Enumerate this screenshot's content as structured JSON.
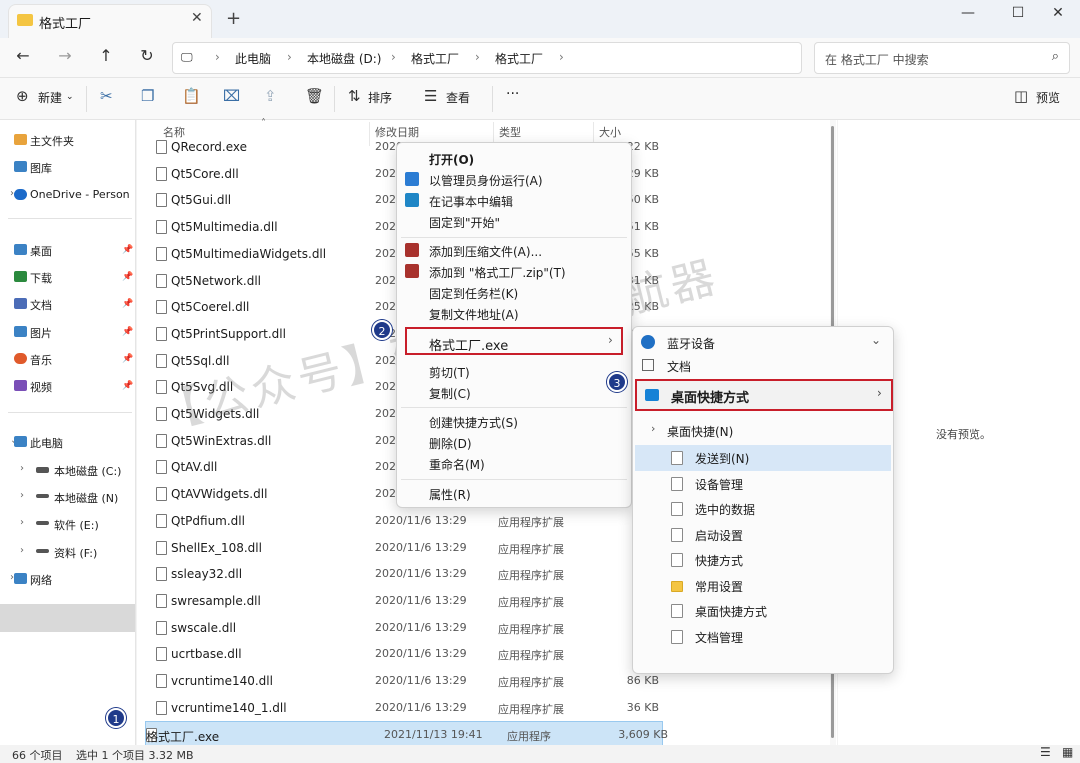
{
  "window": {
    "tab_title": "格式工厂",
    "tab_close": "✕",
    "new_tab": "+"
  },
  "nav_buttons": {
    "back": "←",
    "forward": "→",
    "up": "↑",
    "refresh": "↻"
  },
  "breadcrumb": {
    "pc": "此电脑",
    "drive": "本地磁盘 (D:)",
    "folder1": "格式工厂",
    "folder2": "格式工厂",
    "sep": "›"
  },
  "search": {
    "placeholder": "在 格式工厂 中搜索"
  },
  "toolbar": {
    "new": "新建",
    "sort": "排序",
    "view": "查看",
    "more": "···",
    "preview": "预览"
  },
  "nav_pane": {
    "quick": [
      {
        "label": "主文件夹",
        "color": "#e8a33c"
      },
      {
        "label": "图库",
        "color": "#3b82c4"
      },
      {
        "label": "OneDrive - Person",
        "color": "#1b6ac9"
      }
    ],
    "pinned": [
      {
        "label": "桌面",
        "color": "#3b82c4"
      },
      {
        "label": "下载",
        "color": "#2b8a3e"
      },
      {
        "label": "文档",
        "color": "#4b6cb7"
      },
      {
        "label": "图片",
        "color": "#3b82c4"
      },
      {
        "label": "音乐",
        "color": "#e05a2b"
      },
      {
        "label": "视频",
        "color": "#7a4fb7"
      }
    ],
    "tree": [
      {
        "label": "此电脑",
        "color": "#3b82c4"
      },
      {
        "label": "本地磁盘 (C:)",
        "color": "#555555"
      },
      {
        "label": "本地磁盘 (N)",
        "color": "#555555"
      },
      {
        "label": "软件 (E:)",
        "color": "#555555"
      },
      {
        "label": "资料 (F:)",
        "color": "#555555"
      },
      {
        "label": "网络",
        "color": "#3b82c4"
      }
    ]
  },
  "columns": {
    "name": "名称",
    "date": "修改日期",
    "type": "类型",
    "size": "大小"
  },
  "files": [
    {
      "name": "QRecord.exe",
      "date": "2020",
      "type": "",
      "size": "22 KB"
    },
    {
      "name": "Qt5Core.dll",
      "date": "2020",
      "type": "",
      "size": "29 KB"
    },
    {
      "name": "Qt5Gui.dll",
      "date": "2020",
      "type": "",
      "size": "50 KB"
    },
    {
      "name": "Qt5Multimedia.dll",
      "date": "2020",
      "type": "",
      "size": "51 KB"
    },
    {
      "name": "Qt5MultimediaWidgets.dll",
      "date": "2020",
      "type": "",
      "size": "55 KB"
    },
    {
      "name": "Qt5Network.dll",
      "date": "2020",
      "type": "",
      "size": "31 KB"
    },
    {
      "name": "Qt5Coerel.dll",
      "date": "2020",
      "type": "",
      "size": "25 KB"
    },
    {
      "name": "Qt5PrintSupport.dll",
      "date": "2020",
      "type": "",
      "size": "36 KB"
    },
    {
      "name": "Qt5Sql.dll",
      "date": "2020",
      "type": "",
      "size": "22 KB"
    },
    {
      "name": "Qt5Svg.dll",
      "date": "2020",
      "type": "",
      "size": "31 KB"
    },
    {
      "name": "Qt5Widgets.dll",
      "date": "2020",
      "type": "",
      "size": "44 KB"
    },
    {
      "name": "Qt5WinExtras.dll",
      "date": "2020",
      "type": "",
      "size": "38 KB"
    },
    {
      "name": "QtAV.dll",
      "date": "2020",
      "type": "",
      "size": "44 KB"
    },
    {
      "name": "QtAVWidgets.dll",
      "date": "2020",
      "type": "",
      "size": "83 KB"
    },
    {
      "name": "QtPdfium.dll",
      "date": "2020/11/6 13:29",
      "type": "应用程序扩展",
      "size": "4,1"
    },
    {
      "name": "ShellEx_108.dll",
      "date": "2020/11/6 13:29",
      "type": "应用程序扩展",
      "size": "3"
    },
    {
      "name": "ssleay32.dll",
      "date": "2020/11/6 13:29",
      "type": "应用程序扩展",
      "size": "30"
    },
    {
      "name": "swresample.dll",
      "date": "2020/11/6 13:29",
      "type": "应用程序扩展",
      "size": "1,0"
    },
    {
      "name": "swscale.dll",
      "date": "2020/11/6 13:29",
      "type": "应用程序扩展",
      "size": "3"
    },
    {
      "name": "ucrtbase.dll",
      "date": "2020/11/6 13:29",
      "type": "应用程序扩展",
      "size": "1,0"
    },
    {
      "name": "vcruntime140.dll",
      "date": "2020/11/6 13:29",
      "type": "应用程序扩展",
      "size": "86 KB"
    },
    {
      "name": "vcruntime140_1.dll",
      "date": "2020/11/6 13:29",
      "type": "应用程序扩展",
      "size": "36 KB"
    },
    {
      "name": "格式工厂.exe",
      "date": "2021/11/13 19:41",
      "type": "应用程序",
      "size": "3,609 KB"
    }
  ],
  "preview_text": "没有预览。",
  "status": {
    "count": "66 个项目",
    "selected": "选中 1 个项目  3.32 MB"
  },
  "context_menu": {
    "items": [
      {
        "label": "打开(O)",
        "icon": "none",
        "color": ""
      },
      {
        "label": "以管理员身份运行(A)",
        "icon": "shield-icon",
        "color": "#2b7cd3"
      },
      {
        "label": "在记事本中编辑",
        "icon": "notepad-icon",
        "color": "#1f86c6"
      },
      {
        "label": "固定到\"开始\"",
        "icon": "none",
        "color": ""
      },
      {
        "label": "添加到压缩文件(A)...",
        "icon": "winrar-icon",
        "color": "#a8322d"
      },
      {
        "label": "添加到 \"格式工厂.zip\"(T)",
        "icon": "winrar-icon",
        "color": "#a8322d"
      },
      {
        "label": "固定到任务栏(K)",
        "icon": "none",
        "color": ""
      },
      {
        "label": "复制文件地址(A)",
        "icon": "none",
        "color": ""
      }
    ],
    "sub_label": "格式工厂.exe",
    "items2": [
      {
        "label": "剪切(T)"
      },
      {
        "label": "复制(C)"
      },
      {
        "label": "创建快捷方式(S)"
      },
      {
        "label": "删除(D)"
      },
      {
        "label": "重命名(M)"
      },
      {
        "label": "属性(R)"
      }
    ]
  },
  "submenu": {
    "item1": "蓝牙设备",
    "item2": "文档",
    "highlight": "桌面快捷方式",
    "group": "桌面快捷(N)",
    "items": [
      {
        "label": "发送到(N)",
        "icon": "file"
      },
      {
        "label": "设备管理",
        "icon": "file"
      },
      {
        "label": "选中的数据",
        "icon": "file"
      },
      {
        "label": "启动设置",
        "icon": "file"
      },
      {
        "label": "快捷方式",
        "icon": "file"
      },
      {
        "label": "常用设置",
        "icon": "folder"
      },
      {
        "label": "桌面快捷方式",
        "icon": "file"
      },
      {
        "label": "文档管理",
        "icon": "file"
      }
    ]
  },
  "badges": [
    "1",
    "2",
    "3"
  ],
  "watermark": "【公众号】软件安装导航器"
}
